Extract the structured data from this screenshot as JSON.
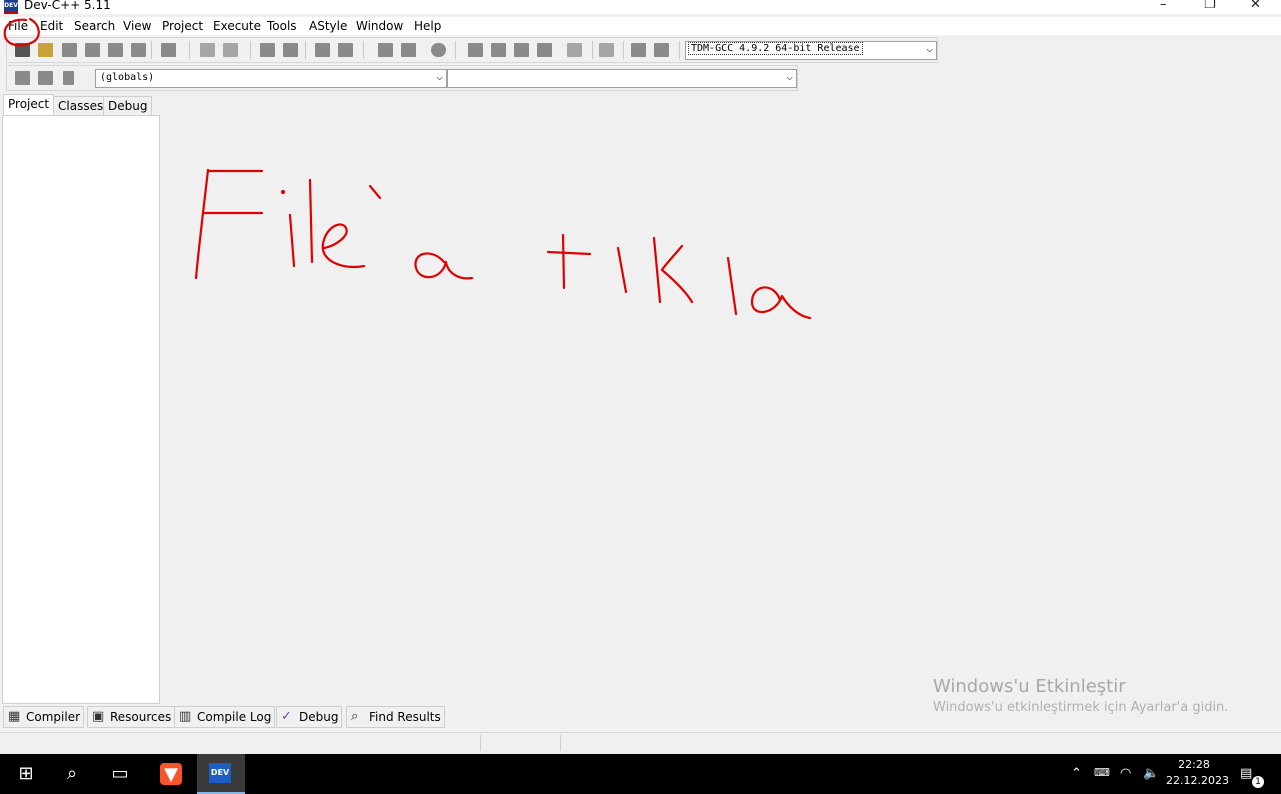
{
  "window": {
    "title": "Dev-C++ 5.11",
    "app_icon_text": "DEV",
    "minimize": "–",
    "restore": "❐",
    "close": "✕"
  },
  "menu": [
    "File",
    "Edit",
    "Search",
    "View",
    "Project",
    "Execute",
    "Tools",
    "AStyle",
    "Window",
    "Help"
  ],
  "toolbar": {
    "compiler_selected": "TDM-GCC 4.9.2 64-bit Release",
    "scope_selected": "(globals)",
    "member_selected": ""
  },
  "left_tabs": [
    "Project",
    "Classes",
    "Debug"
  ],
  "bottom_tabs": [
    {
      "label": "Compiler",
      "icon": "grid-icon"
    },
    {
      "label": "Resources",
      "icon": "resources-icon"
    },
    {
      "label": "Compile Log",
      "icon": "chart-icon"
    },
    {
      "label": "Debug",
      "icon": "checkmark-icon"
    },
    {
      "label": "Find Results",
      "icon": "find-icon"
    }
  ],
  "annotation": {
    "handwritten_text": "File'a tıkla",
    "color": "#e00000"
  },
  "watermark": {
    "title": "Windows'u Etkinleştir",
    "subtitle": "Windows'u etkinleştirmek için Ayarlar'a gidin."
  },
  "taskbar": {
    "time": "22:28",
    "date": "22.12.2023",
    "notification_count": "1",
    "devcpp_label": "DEV"
  },
  "colors": {
    "accent_red": "#e00000",
    "taskbar": "#000000",
    "brave": "#fb542b",
    "devcpp": "#1b5fc4"
  }
}
